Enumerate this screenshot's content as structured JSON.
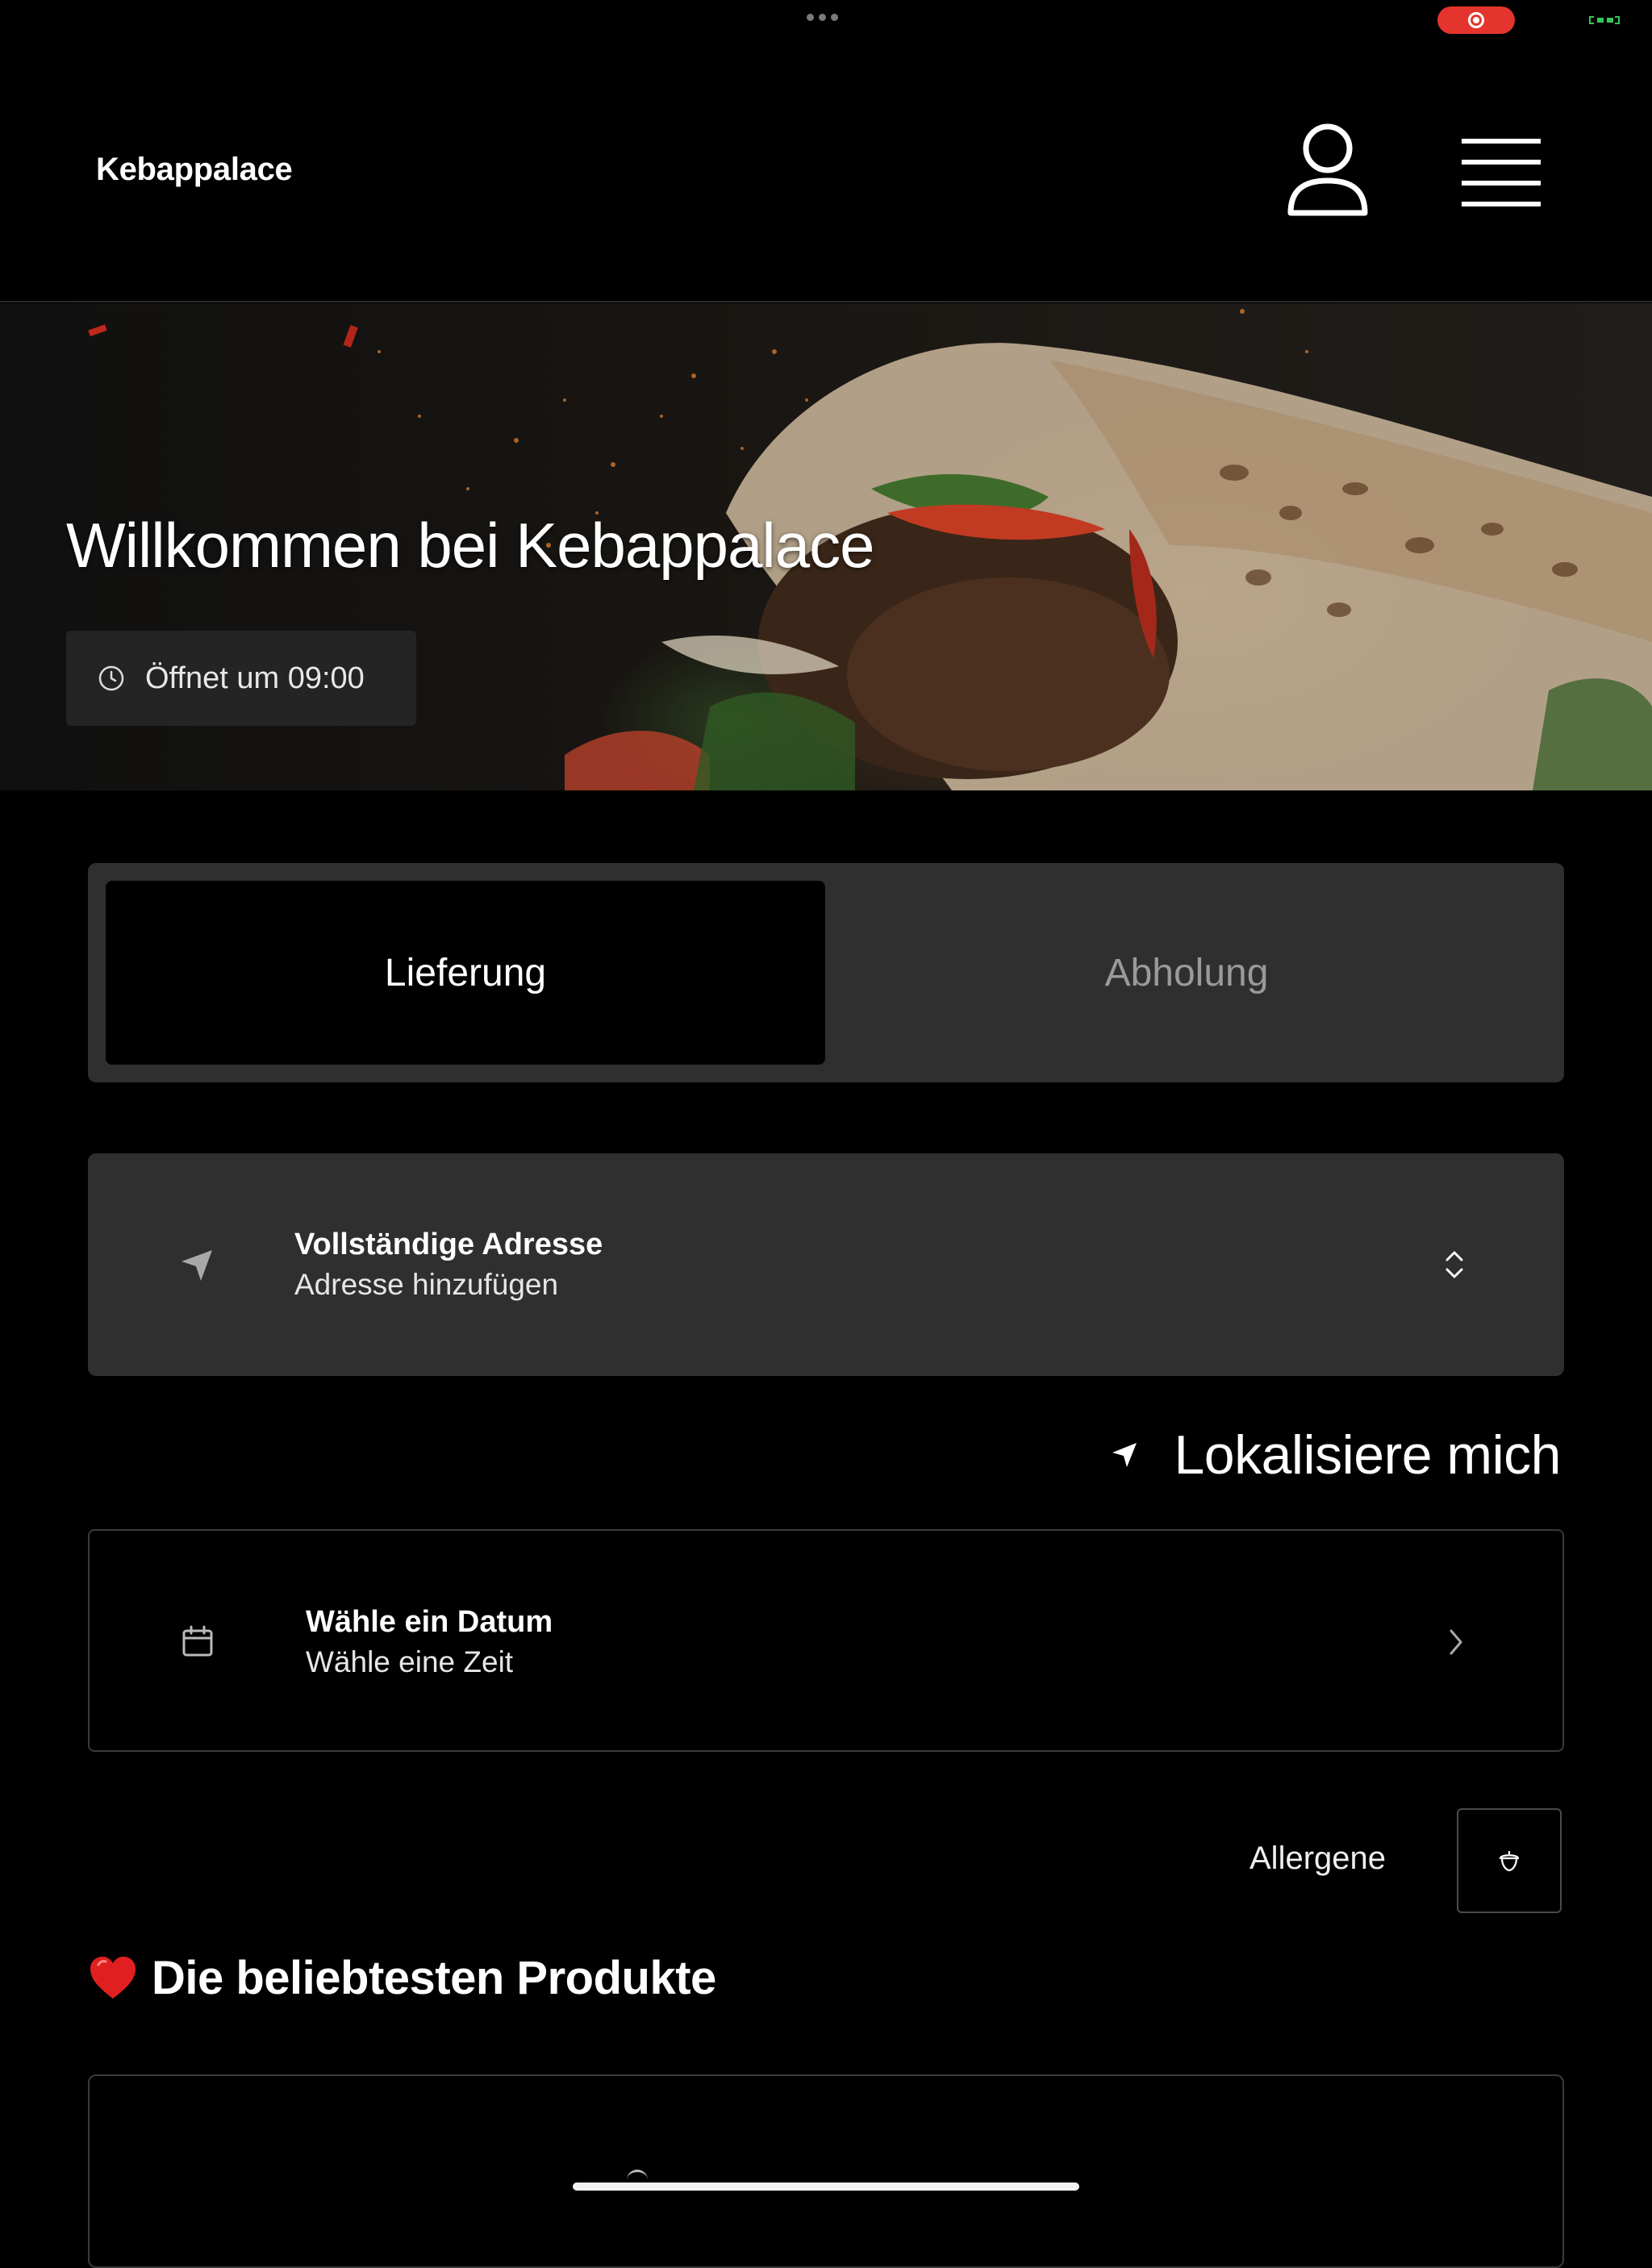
{
  "app": {
    "brand": "Kebappalace"
  },
  "hero": {
    "title": "Willkommen bei Kebappalace",
    "opening_hours": "Öffnet um 09:00"
  },
  "order_mode": {
    "options": [
      {
        "label": "Lieferung",
        "selected": true
      },
      {
        "label": "Abholung",
        "selected": false
      }
    ]
  },
  "address": {
    "title": "Vollständige Adresse",
    "subtitle": "Adresse hinzufügen"
  },
  "locate": {
    "label": "Lokalisiere mich"
  },
  "schedule": {
    "date_label": "Wähle ein Datum",
    "time_label": "Wähle eine Zeit"
  },
  "allergens": {
    "label": "Allergene"
  },
  "popular": {
    "title": "Die beliebtesten Produkte"
  },
  "colors": {
    "background": "#000000",
    "card": "#2f2f2f",
    "recording": "#e5342d",
    "heart": "#e02020"
  }
}
